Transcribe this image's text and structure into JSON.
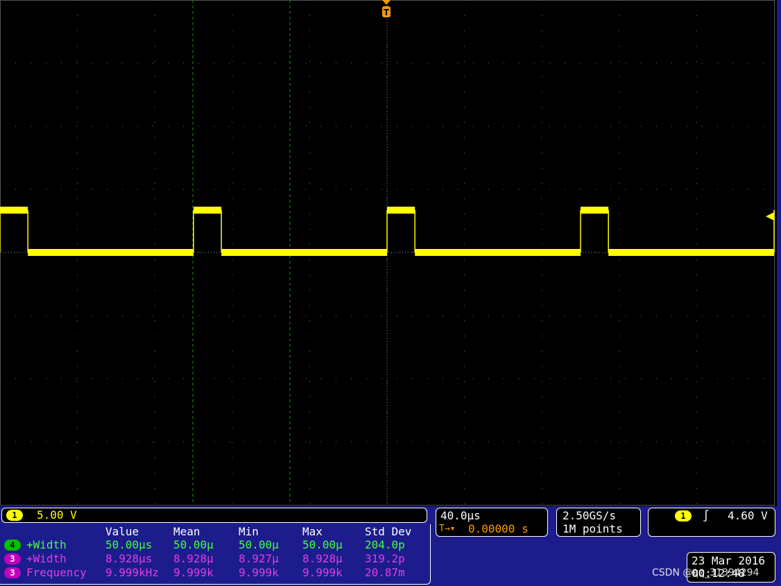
{
  "channel1": {
    "badge": "1",
    "scale": "5.00 V",
    "color": "#ffff00"
  },
  "timebase": {
    "horizontal_scale": "40.0µs",
    "trigger_position": "0.00000 s"
  },
  "acquisition": {
    "sample_rate": "2.50GS/s",
    "record_length": "1M points"
  },
  "trigger": {
    "badge": "1",
    "slope_icon": "rising-edge-icon",
    "level": "4.60 V"
  },
  "datetime": {
    "date": "23 Mar 2016",
    "time": "00:12:48"
  },
  "watermark": "CSDN @qq_31394294",
  "measurements": {
    "headers": [
      "Value",
      "Mean",
      "Min",
      "Max",
      "Std Dev"
    ],
    "rows": [
      {
        "badge": "4",
        "name": "+Width",
        "value": "50.00µs",
        "mean": "50.00µ",
        "min": "50.00µ",
        "max": "50.00µ",
        "std": "204.0p",
        "color": "#44ff44"
      },
      {
        "badge": "3",
        "name": "+Width",
        "value": "8.928µs",
        "mean": "8.928µ",
        "min": "8.927µ",
        "max": "8.928µ",
        "std": "319.2p",
        "color": "#e040e0"
      },
      {
        "badge": "3",
        "name": "Frequency",
        "value": "9.999kHz",
        "mean": "9.999k",
        "min": "9.999k",
        "max": "9.999k",
        "std": "20.87m",
        "color": "#e040e0"
      }
    ]
  },
  "waveform": {
    "high_level": "High",
    "period_divisions": 2.5,
    "pulse_width_divisions": 0.36,
    "first_rising_division": -0.36
  }
}
